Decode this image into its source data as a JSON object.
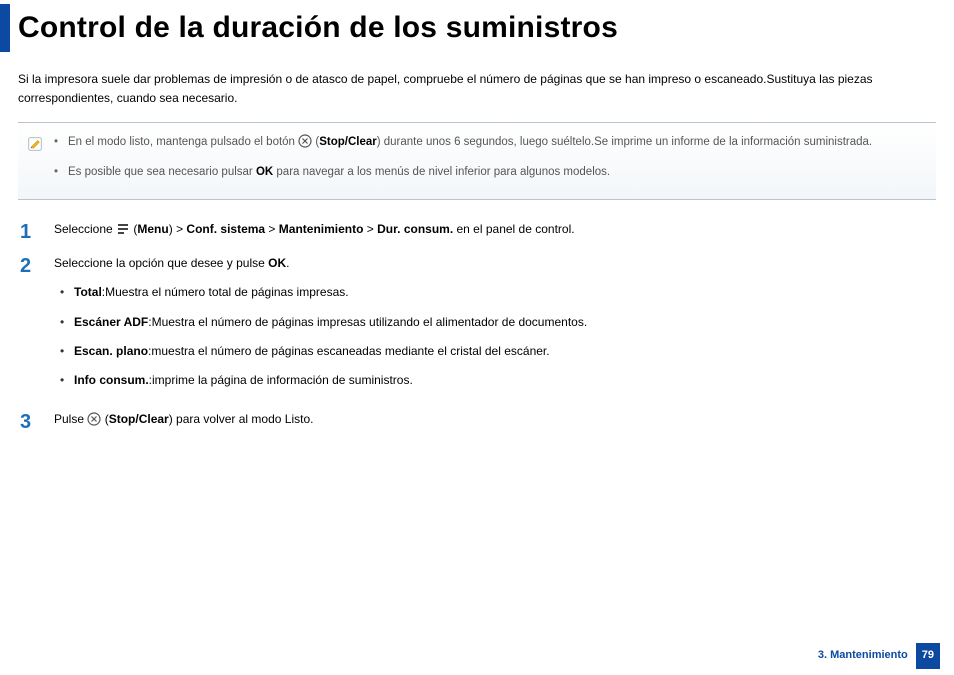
{
  "title": "Control de la duración de los suministros",
  "intro": "Si la impresora suele dar problemas de impresión o de atasco de papel, compruebe el número de páginas que se han impreso o escaneado.Sustituya las piezas correspondientes, cuando sea necesario.",
  "note": {
    "item1_a": "En el modo listo, mantenga pulsado el botón ",
    "item1_b": "(",
    "item1_c": "Stop/Clear",
    "item1_d": ") durante unos 6 segundos, luego suéltelo.Se imprime un informe de la información suministrada.",
    "item2_a": "Es posible que sea necesario pulsar ",
    "item2_b": "OK",
    "item2_c": " para navegar a los menús de nivel inferior para algunos modelos."
  },
  "steps": {
    "s1": {
      "num": "1",
      "a": "Seleccione ",
      "b": "(",
      "c": "Menu",
      "d": ") > ",
      "e": "Conf. sistema",
      "f": " > ",
      "g": "Mantenimiento",
      "h": " > ",
      "i": "Dur. consum.",
      "j": " en el panel de control."
    },
    "s2": {
      "num": "2",
      "a": "Seleccione la opción que desee y pulse ",
      "b": "OK",
      "c": ".",
      "bullets": {
        "b1_a": "Total",
        "b1_b": ":Muestra el número total de páginas impresas.",
        "b2_a": "Escáner ADF",
        "b2_b": ":Muestra el número de páginas impresas utilizando el alimentador de documentos.",
        "b3_a": "Escan. plano",
        "b3_b": ":muestra el número de páginas escaneadas mediante el cristal del escáner.",
        "b4_a": "Info consum.",
        "b4_b": ":imprime la página de información de suministros."
      }
    },
    "s3": {
      "num": "3",
      "a": "Pulse ",
      "b": "(",
      "c": "Stop/Clear",
      "d": ") para volver al modo Listo."
    }
  },
  "footer": {
    "chapter": "3. Mantenimiento",
    "page": "79"
  }
}
